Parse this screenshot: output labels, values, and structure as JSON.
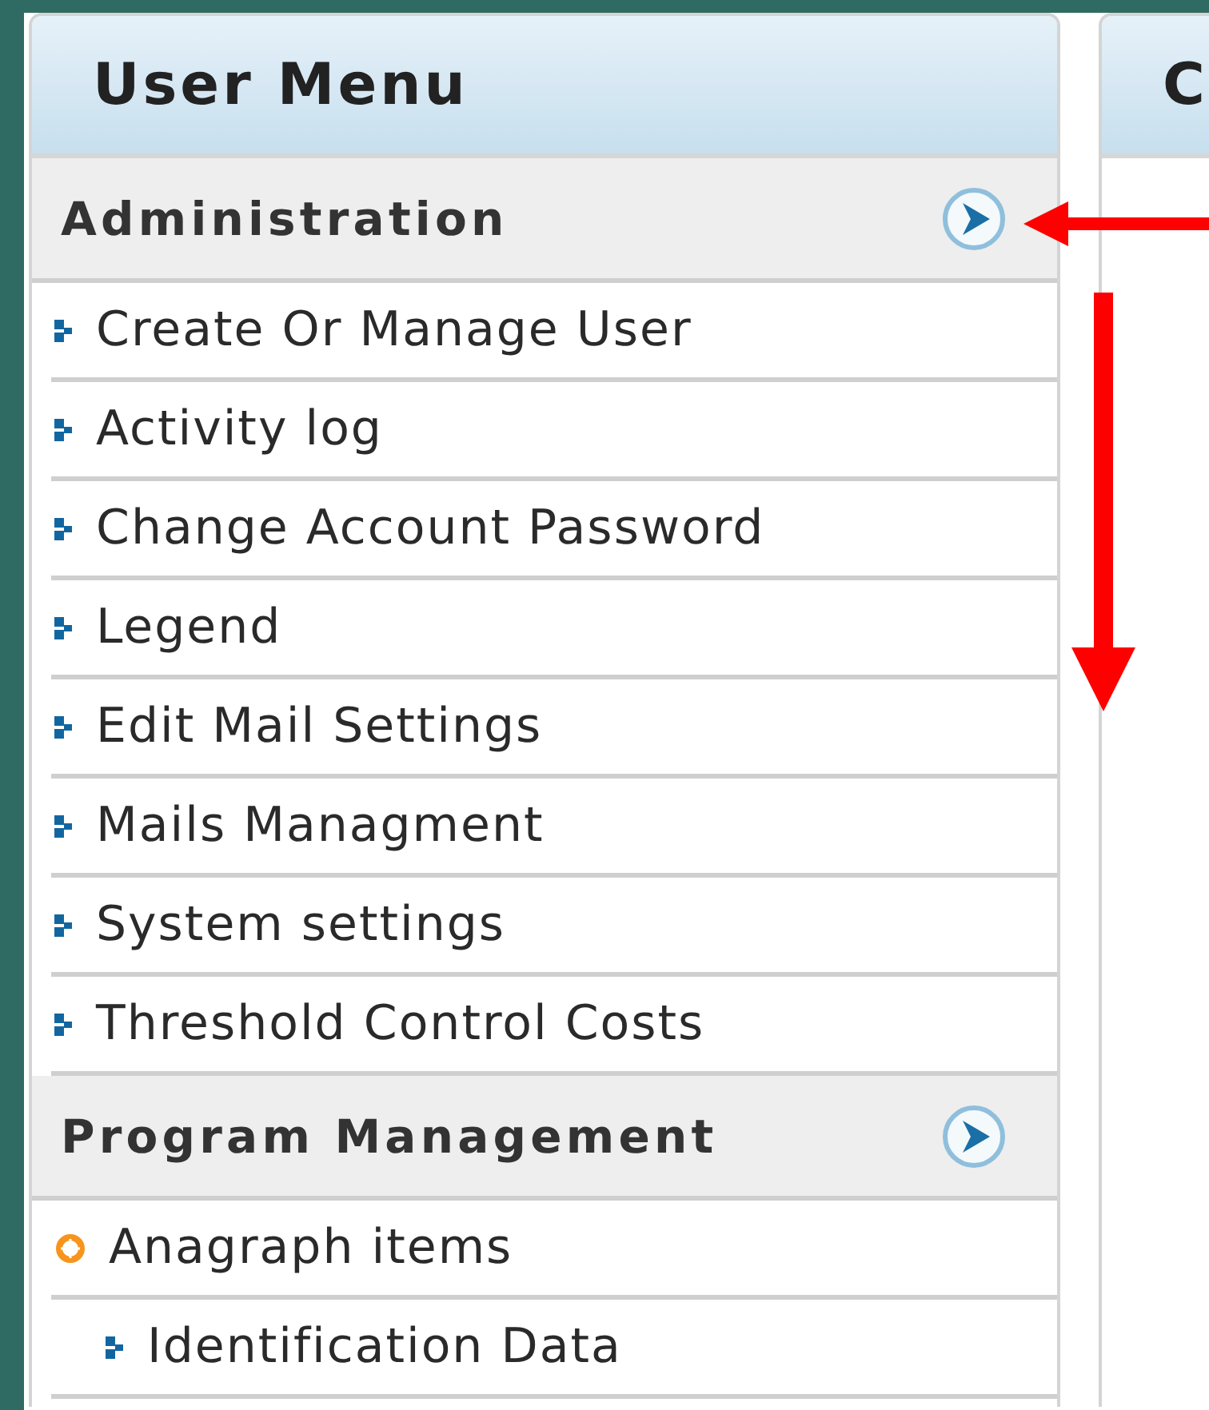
{
  "user_menu": {
    "title": "User Menu",
    "sections": [
      {
        "title": "Administration",
        "items": [
          {
            "label": "Create Or Manage User"
          },
          {
            "label": "Activity log"
          },
          {
            "label": "Change Account Password"
          },
          {
            "label": "Legend"
          },
          {
            "label": "Edit Mail Settings"
          },
          {
            "label": "Mails Managment"
          },
          {
            "label": "System settings"
          },
          {
            "label": "Threshold Control Costs"
          }
        ]
      },
      {
        "title": "Program Management",
        "items": [
          {
            "label": "Anagraph items",
            "children": [
              {
                "label": "Identification Data"
              }
            ]
          }
        ]
      }
    ]
  },
  "second_panel": {
    "title": "C"
  }
}
